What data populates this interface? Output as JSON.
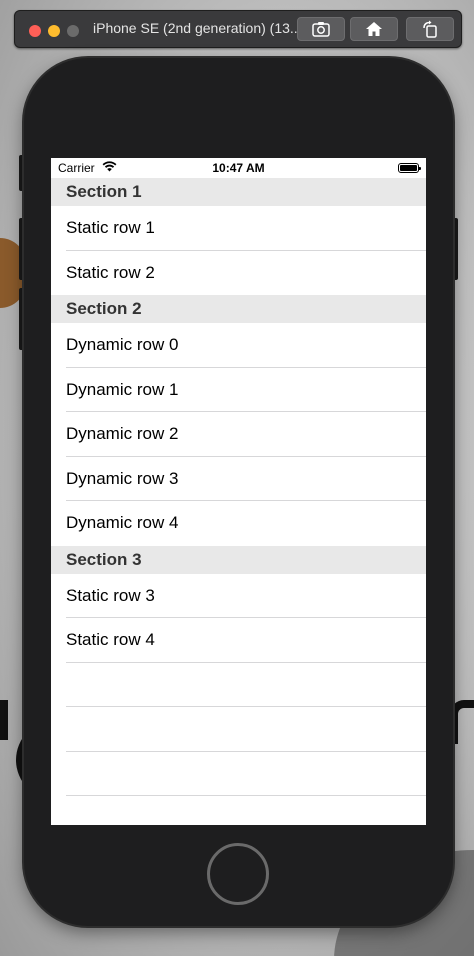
{
  "window": {
    "title": "iPhone SE (2nd generation) (13...",
    "toolbar_buttons": [
      "screenshot-icon",
      "home-icon",
      "rotate-icon"
    ]
  },
  "status_bar": {
    "carrier": "Carrier",
    "time": "10:47 AM",
    "battery_level": 1.0
  },
  "sections": [
    {
      "header": "Section 1",
      "rows": [
        "Static row 1",
        "Static row 2"
      ]
    },
    {
      "header": "Section 2",
      "rows": [
        "Dynamic row 0",
        "Dynamic row 1",
        "Dynamic row 2",
        "Dynamic row 3",
        "Dynamic row 4"
      ]
    },
    {
      "header": "Section 3",
      "rows": [
        "Static row 3",
        "Static row 4"
      ]
    }
  ],
  "colors": {
    "section_header_bg": "#e8e8e8",
    "separator": "#d7d7d9",
    "device_body": "#1e1e1f"
  }
}
